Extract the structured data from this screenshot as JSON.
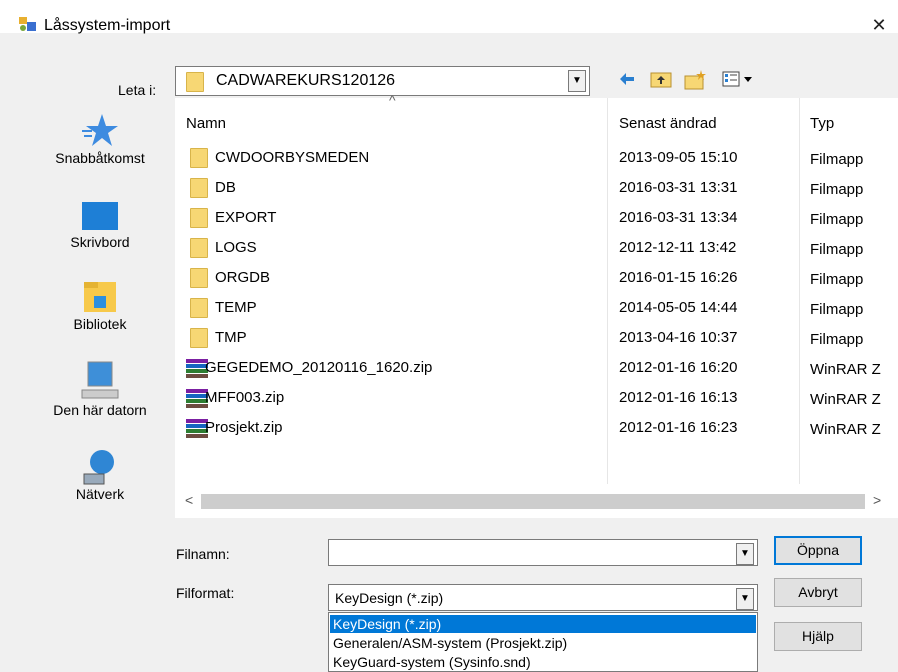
{
  "window": {
    "title": "Låssystem-import",
    "close_glyph": "✕"
  },
  "lookin": {
    "label": "Leta i:",
    "value": "CADWAREKURS120126"
  },
  "toolbar": {
    "back_icon": "arrow-left-icon",
    "up_icon": "folder-up-icon",
    "new_folder_icon": "new-folder-icon",
    "view_icon": "view-menu-icon"
  },
  "places": [
    {
      "label": "Snabbåtkomst",
      "icon": "star-icon"
    },
    {
      "label": "Skrivbord",
      "icon": "desktop-icon"
    },
    {
      "label": "Bibliotek",
      "icon": "library-icon"
    },
    {
      "label": "Den här datorn",
      "icon": "computer-icon"
    },
    {
      "label": "Nätverk",
      "icon": "network-icon"
    }
  ],
  "columns": {
    "name": "Namn",
    "date": "Senast ändrad",
    "type": "Typ"
  },
  "files": [
    {
      "name": "CWDOORBYSMEDEN",
      "date": "2013-09-05 15:10",
      "type": "Filmapp",
      "kind": "folder"
    },
    {
      "name": "DB",
      "date": "2016-03-31 13:31",
      "type": "Filmapp",
      "kind": "folder"
    },
    {
      "name": "EXPORT",
      "date": "2016-03-31 13:34",
      "type": "Filmapp",
      "kind": "folder"
    },
    {
      "name": "LOGS",
      "date": "2012-12-11 13:42",
      "type": "Filmapp",
      "kind": "folder"
    },
    {
      "name": "ORGDB",
      "date": "2016-01-15 16:26",
      "type": "Filmapp",
      "kind": "folder"
    },
    {
      "name": "TEMP",
      "date": "2014-05-05 14:44",
      "type": "Filmapp",
      "kind": "folder"
    },
    {
      "name": "TMP",
      "date": "2013-04-16 10:37",
      "type": "Filmapp",
      "kind": "folder"
    },
    {
      "name": "GEGEDEMO_20120116_1620.zip",
      "date": "2012-01-16 16:20",
      "type": "WinRAR Z",
      "kind": "zip"
    },
    {
      "name": "MFF003.zip",
      "date": "2012-01-16 16:13",
      "type": "WinRAR Z",
      "kind": "zip"
    },
    {
      "name": "Prosjekt.zip",
      "date": "2012-01-16 16:23",
      "type": "WinRAR Z",
      "kind": "zip"
    }
  ],
  "filename": {
    "label": "Filnamn:",
    "value": ""
  },
  "filter": {
    "label": "Filformat:",
    "value": "KeyDesign (*.zip)",
    "options": [
      "KeyDesign (*.zip)",
      "Generalen/ASM-system (Prosjekt.zip)",
      "KeyGuard-system (Sysinfo.snd)"
    ]
  },
  "buttons": {
    "open": "Öppna",
    "cancel": "Avbryt",
    "help": "Hjälp"
  },
  "colors": {
    "accent": "#0078d7",
    "folder": "#f7d774"
  }
}
